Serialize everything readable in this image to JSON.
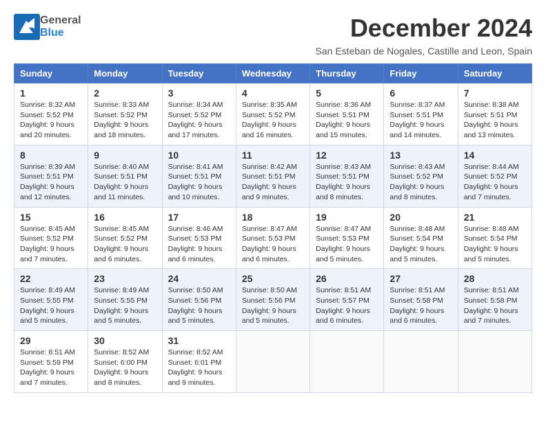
{
  "header": {
    "logo_general": "General",
    "logo_blue": "Blue",
    "month_title": "December 2024",
    "subtitle": "San Esteban de Nogales, Castille and Leon, Spain"
  },
  "weekdays": [
    "Sunday",
    "Monday",
    "Tuesday",
    "Wednesday",
    "Thursday",
    "Friday",
    "Saturday"
  ],
  "weeks": [
    [
      {
        "day": "1",
        "sunrise": "8:32 AM",
        "sunset": "5:52 PM",
        "daylight": "9 hours and 20 minutes."
      },
      {
        "day": "2",
        "sunrise": "8:33 AM",
        "sunset": "5:52 PM",
        "daylight": "9 hours and 18 minutes."
      },
      {
        "day": "3",
        "sunrise": "8:34 AM",
        "sunset": "5:52 PM",
        "daylight": "9 hours and 17 minutes."
      },
      {
        "day": "4",
        "sunrise": "8:35 AM",
        "sunset": "5:52 PM",
        "daylight": "9 hours and 16 minutes."
      },
      {
        "day": "5",
        "sunrise": "8:36 AM",
        "sunset": "5:51 PM",
        "daylight": "9 hours and 15 minutes."
      },
      {
        "day": "6",
        "sunrise": "8:37 AM",
        "sunset": "5:51 PM",
        "daylight": "9 hours and 14 minutes."
      },
      {
        "day": "7",
        "sunrise": "8:38 AM",
        "sunset": "5:51 PM",
        "daylight": "9 hours and 13 minutes."
      }
    ],
    [
      {
        "day": "8",
        "sunrise": "8:39 AM",
        "sunset": "5:51 PM",
        "daylight": "9 hours and 12 minutes."
      },
      {
        "day": "9",
        "sunrise": "8:40 AM",
        "sunset": "5:51 PM",
        "daylight": "9 hours and 11 minutes."
      },
      {
        "day": "10",
        "sunrise": "8:41 AM",
        "sunset": "5:51 PM",
        "daylight": "9 hours and 10 minutes."
      },
      {
        "day": "11",
        "sunrise": "8:42 AM",
        "sunset": "5:51 PM",
        "daylight": "9 hours and 9 minutes."
      },
      {
        "day": "12",
        "sunrise": "8:43 AM",
        "sunset": "5:51 PM",
        "daylight": "9 hours and 8 minutes."
      },
      {
        "day": "13",
        "sunrise": "8:43 AM",
        "sunset": "5:52 PM",
        "daylight": "9 hours and 8 minutes."
      },
      {
        "day": "14",
        "sunrise": "8:44 AM",
        "sunset": "5:52 PM",
        "daylight": "9 hours and 7 minutes."
      }
    ],
    [
      {
        "day": "15",
        "sunrise": "8:45 AM",
        "sunset": "5:52 PM",
        "daylight": "9 hours and 7 minutes."
      },
      {
        "day": "16",
        "sunrise": "8:45 AM",
        "sunset": "5:52 PM",
        "daylight": "9 hours and 6 minutes."
      },
      {
        "day": "17",
        "sunrise": "8:46 AM",
        "sunset": "5:53 PM",
        "daylight": "9 hours and 6 minutes."
      },
      {
        "day": "18",
        "sunrise": "8:47 AM",
        "sunset": "5:53 PM",
        "daylight": "9 hours and 6 minutes."
      },
      {
        "day": "19",
        "sunrise": "8:47 AM",
        "sunset": "5:53 PM",
        "daylight": "9 hours and 5 minutes."
      },
      {
        "day": "20",
        "sunrise": "8:48 AM",
        "sunset": "5:54 PM",
        "daylight": "9 hours and 5 minutes."
      },
      {
        "day": "21",
        "sunrise": "8:48 AM",
        "sunset": "5:54 PM",
        "daylight": "9 hours and 5 minutes."
      }
    ],
    [
      {
        "day": "22",
        "sunrise": "8:49 AM",
        "sunset": "5:55 PM",
        "daylight": "9 hours and 5 minutes."
      },
      {
        "day": "23",
        "sunrise": "8:49 AM",
        "sunset": "5:55 PM",
        "daylight": "9 hours and 5 minutes."
      },
      {
        "day": "24",
        "sunrise": "8:50 AM",
        "sunset": "5:56 PM",
        "daylight": "9 hours and 5 minutes."
      },
      {
        "day": "25",
        "sunrise": "8:50 AM",
        "sunset": "5:56 PM",
        "daylight": "9 hours and 5 minutes."
      },
      {
        "day": "26",
        "sunrise": "8:51 AM",
        "sunset": "5:57 PM",
        "daylight": "9 hours and 6 minutes."
      },
      {
        "day": "27",
        "sunrise": "8:51 AM",
        "sunset": "5:58 PM",
        "daylight": "9 hours and 6 minutes."
      },
      {
        "day": "28",
        "sunrise": "8:51 AM",
        "sunset": "5:58 PM",
        "daylight": "9 hours and 7 minutes."
      }
    ],
    [
      {
        "day": "29",
        "sunrise": "8:51 AM",
        "sunset": "5:59 PM",
        "daylight": "9 hours and 7 minutes."
      },
      {
        "day": "30",
        "sunrise": "8:52 AM",
        "sunset": "6:00 PM",
        "daylight": "9 hours and 8 minutes."
      },
      {
        "day": "31",
        "sunrise": "8:52 AM",
        "sunset": "6:01 PM",
        "daylight": "9 hours and 9 minutes."
      },
      null,
      null,
      null,
      null
    ]
  ]
}
